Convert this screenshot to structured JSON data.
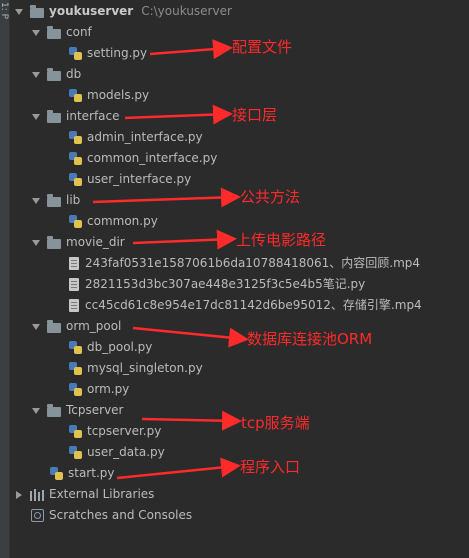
{
  "sidebar_tab": "1: P",
  "project": {
    "name": "youkuserver",
    "path": "C:\\youkuserver"
  },
  "tree": {
    "conf": "conf",
    "setting_py": "setting.py",
    "db": "db",
    "models_py": "models.py",
    "interface": "interface",
    "admin_interface_py": "admin_interface.py",
    "common_interface_py": "common_interface.py",
    "user_interface_py": "user_interface.py",
    "lib": "lib",
    "common_py": "common.py",
    "movie_dir": "movie_dir",
    "movie1": "243faf0531e1587061b6da10788418061、内容回顾.mp4",
    "movie2": "2821153d3bc307ae448e3125f3c5e4b5笔记.py",
    "movie3": "cc45cd61c8e954e17dc81142d6be95012、存储引擎.mp4",
    "orm_pool": "orm_pool",
    "db_pool_py": "db_pool.py",
    "mysql_singleton_py": "mysql_singleton.py",
    "orm_py": "orm.py",
    "tcpserver": "Tcpserver",
    "tcpserver_py": "tcpserver.py",
    "user_data_py": "user_data.py",
    "start_py": "start.py",
    "external_libraries": "External Libraries",
    "scratches": "Scratches and Consoles"
  },
  "annotations": {
    "config": "配置文件",
    "interface": "接口层",
    "common": "公共方法",
    "upload": "上传电影路径",
    "orm": "数据库连接池ORM",
    "tcp": "tcp服务端",
    "entry": "程序入口"
  },
  "colors": {
    "background": "#2b2b2b",
    "text": "#bbbbbb",
    "annotation": "#ff2a2a",
    "folder": "#87939a"
  }
}
